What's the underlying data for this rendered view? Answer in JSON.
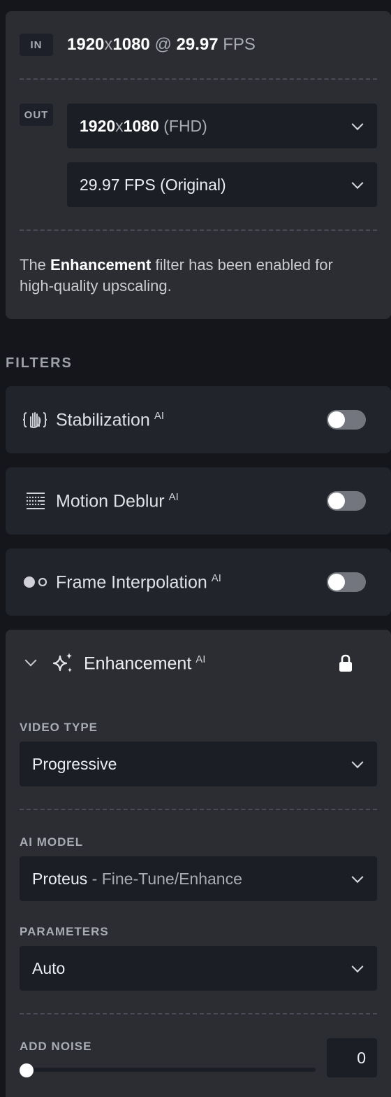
{
  "io": {
    "in_tag": "IN",
    "out_tag": "OUT",
    "input": {
      "width": "1920",
      "x": "x",
      "height": "1080",
      "at": "@",
      "fps": "29.97",
      "fps_unit": "FPS"
    },
    "output_resolution": {
      "width": "1920",
      "x": "x",
      "height": "1080",
      "label": "(FHD)"
    },
    "output_fps": "29.97 FPS (Original)",
    "note": {
      "prefix": "The ",
      "bold": "Enhancement",
      "suffix": " filter has been enabled for high-quality upscaling."
    }
  },
  "filters": {
    "heading": "FILTERS",
    "ai_badge": "AI",
    "items": [
      {
        "name": "Stabilization",
        "icon": "stabilization-hand-icon",
        "enabled": false
      },
      {
        "name": "Motion Deblur",
        "icon": "motion-deblur-icon",
        "enabled": false
      },
      {
        "name": "Frame Interpolation",
        "icon": "frame-interpolation-icon",
        "enabled": false
      }
    ],
    "enhancement": {
      "name": "Enhancement",
      "icon": "sparkles-icon",
      "locked": true,
      "video_type": {
        "label": "VIDEO TYPE",
        "value": "Progressive"
      },
      "ai_model": {
        "label": "AI MODEL",
        "value": "Proteus",
        "separator": " - ",
        "detail": "Fine-Tune/Enhance"
      },
      "parameters": {
        "label": "PARAMETERS",
        "value": "Auto"
      },
      "add_noise": {
        "label": "ADD NOISE",
        "value": "0"
      }
    }
  },
  "colors": {
    "background": "#14161c",
    "card": "#2c2d33",
    "filter_card": "#22242b",
    "input": "#1c1e26",
    "toggle_off": "#73767e"
  }
}
